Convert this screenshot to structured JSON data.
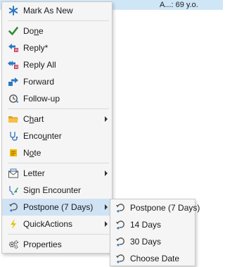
{
  "header": {
    "text": "A...: 69 y.o."
  },
  "menu": {
    "items": [
      {
        "label": "Mark As New",
        "icon": "mark-new-icon"
      },
      {
        "label_pre": "Do",
        "label_u": "n",
        "label_post": "e",
        "icon": "checkmark-icon"
      },
      {
        "label": "Reply*",
        "icon": "reply-icon"
      },
      {
        "label": "Reply All",
        "icon": "reply-all-icon"
      },
      {
        "label": "Forward",
        "icon": "forward-icon"
      },
      {
        "label": "Follow-up",
        "icon": "follow-up-icon"
      },
      {
        "label_pre": "C",
        "label_u": "h",
        "label_post": "art",
        "icon": "chart-folder-icon"
      },
      {
        "label_pre": "Enco",
        "label_u": "u",
        "label_post": "nter",
        "icon": "encounter-icon"
      },
      {
        "label_pre": "N",
        "label_u": "o",
        "label_post": "te",
        "icon": "note-icon"
      },
      {
        "label": "Letter",
        "icon": "letter-icon"
      },
      {
        "label": "Sign Encounter",
        "icon": "sign-encounter-icon"
      },
      {
        "label": "Postpone (7 Days)",
        "icon": "postpone-icon"
      },
      {
        "label": "QuickActions",
        "icon": "lightning-icon"
      },
      {
        "label": "Properties",
        "icon": "properties-icon"
      }
    ]
  },
  "submenu": {
    "items": [
      {
        "label": "Postpone (7 Days)",
        "icon": "postpone-icon"
      },
      {
        "label": "14 Days",
        "icon": "postpone-icon"
      },
      {
        "label": "30 Days",
        "icon": "postpone-icon"
      },
      {
        "label": "Choose Date",
        "icon": "postpone-icon"
      }
    ]
  },
  "colors": {
    "highlight": "#cfe3f4",
    "accent": "#2b78c2",
    "check": "#2e8b2e"
  }
}
